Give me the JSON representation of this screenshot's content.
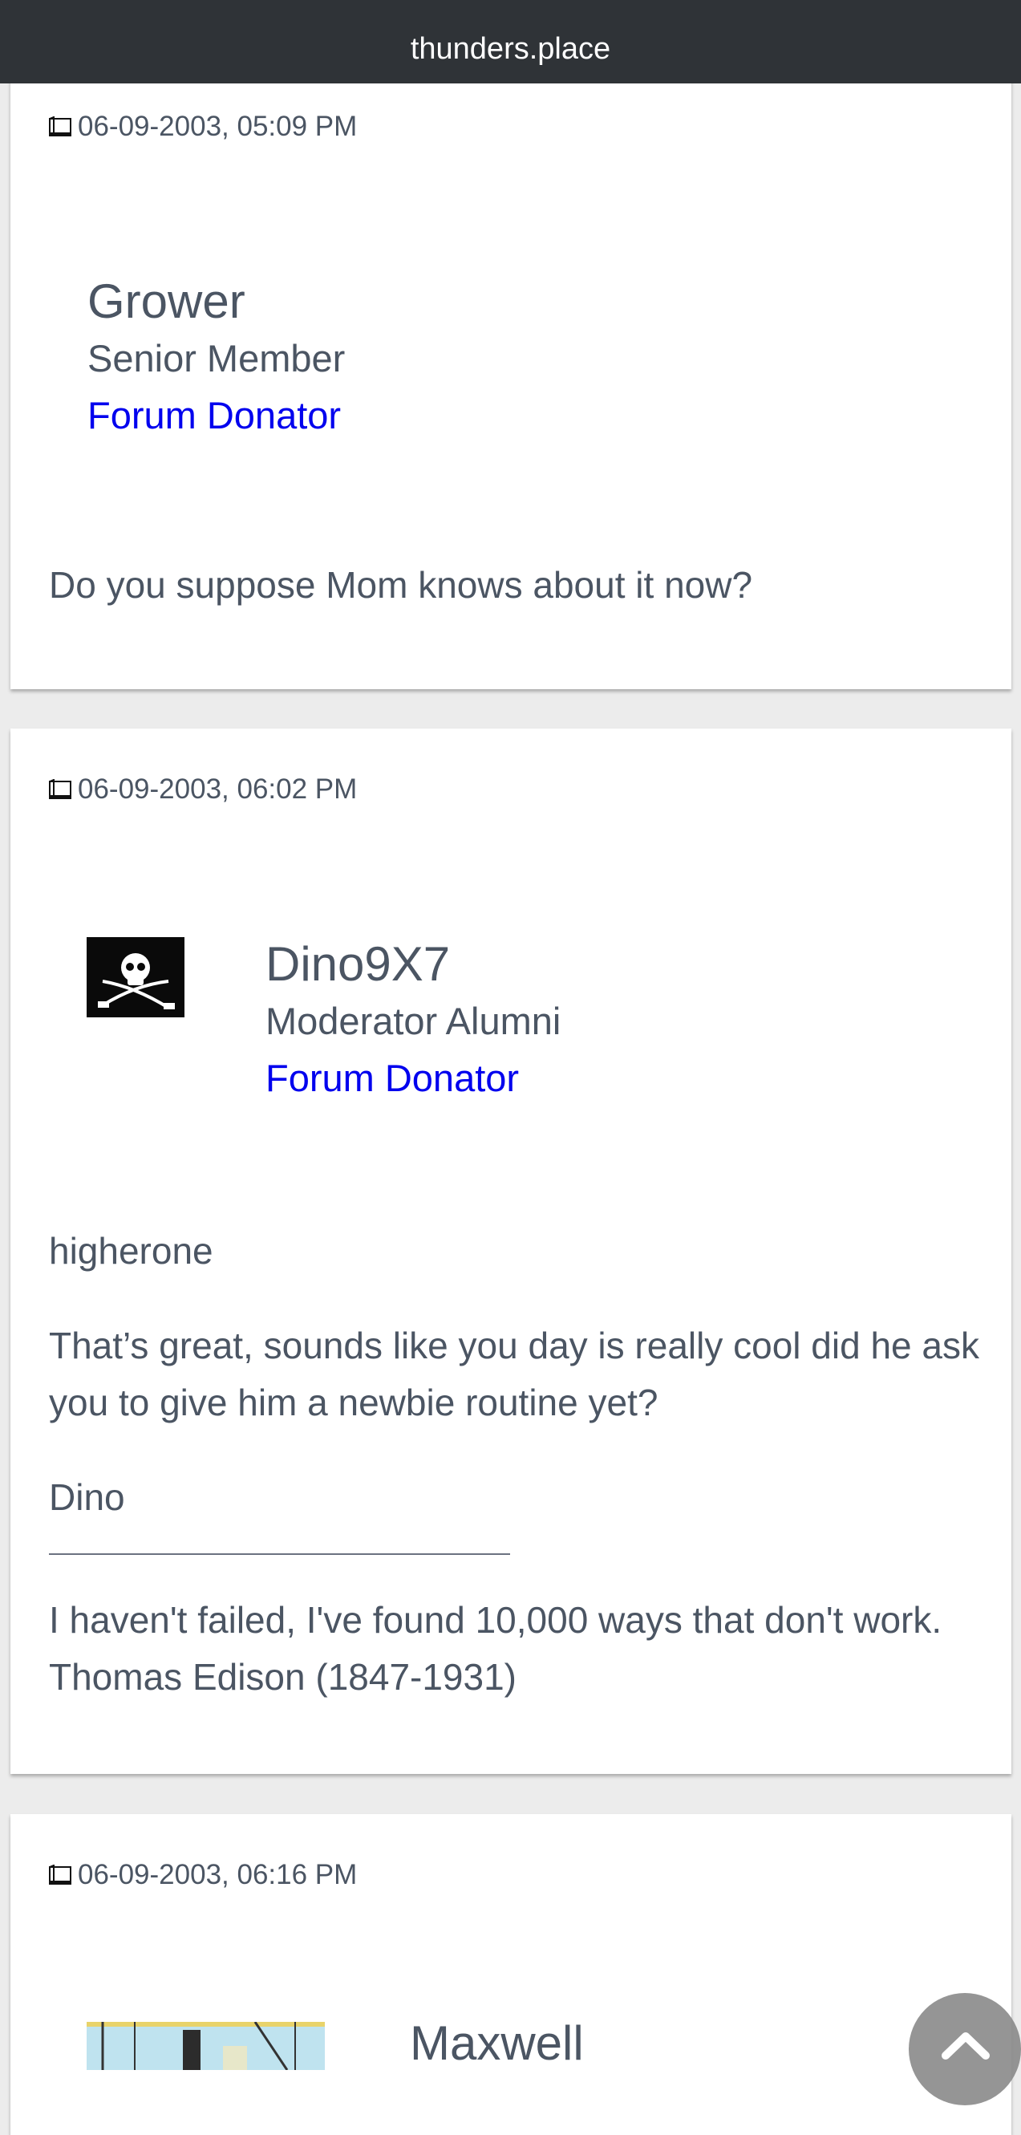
{
  "browser": {
    "url": "thunders.place"
  },
  "posts": [
    {
      "date": "06-09-2003, 05:09 PM",
      "username": "Grower",
      "usertitle": "Senior Member",
      "donator": "Forum Donator",
      "avatar": null,
      "body": [
        "Do you suppose Mom knows about it now?"
      ]
    },
    {
      "date": "06-09-2003, 06:02 PM",
      "username": "Dino9X7",
      "usertitle": "Moderator Alumni",
      "donator": "Forum Donator",
      "avatar": "pirate-flag-avatar",
      "body": [
        "higherone",
        "That’s great, sounds like you day is really cool did he ask you to give him a newbie routine yet?",
        "Dino"
      ],
      "signature": "I haven't failed, I've found 10,000 ways that don't work. Thomas Edison (1847-1931)"
    },
    {
      "date": "06-09-2003, 06:16 PM",
      "username": "Maxwell",
      "avatar": "comic-avatar"
    }
  ],
  "icons": {
    "post": "post-icon",
    "scroll_top": "scroll-top-icon"
  }
}
